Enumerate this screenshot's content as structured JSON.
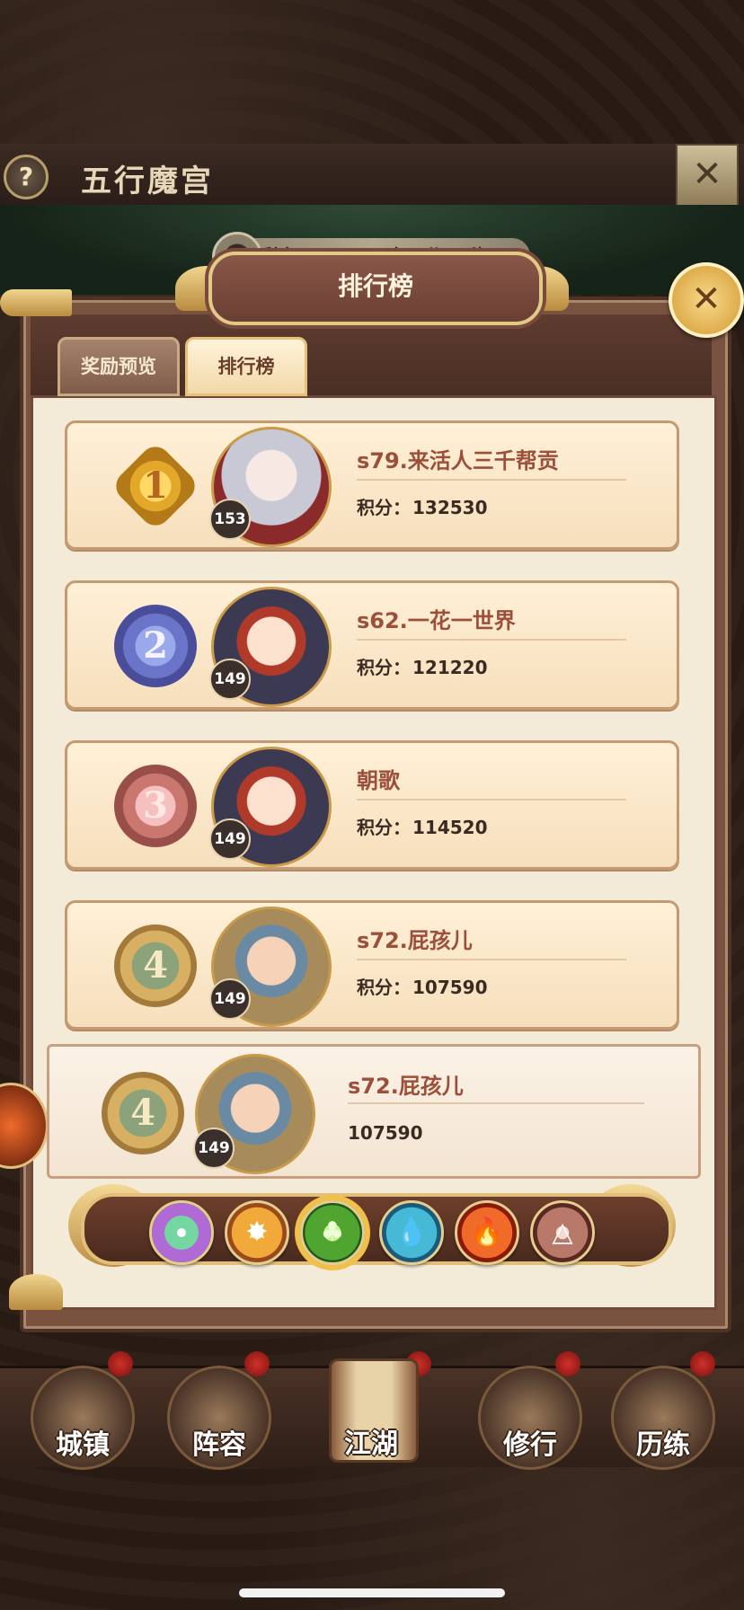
{
  "header": {
    "help_label": "?",
    "mode_title": "五行魔宫",
    "close_icon_glyph": "✕",
    "timer_text": "剩余：11天20时52分34秒"
  },
  "panel": {
    "title": "排行榜",
    "close_glyph": "✕",
    "tabs": [
      {
        "label": "奖励预览",
        "active": false
      },
      {
        "label": "排行榜",
        "active": true
      }
    ]
  },
  "score_prefix": "积分：",
  "rankings": [
    {
      "rank": "1",
      "level": "153",
      "name": "s79.来活人三千帮贡",
      "score": "132530",
      "medal": "gold"
    },
    {
      "rank": "2",
      "level": "149",
      "name": "s62.一花一世界",
      "score": "121220",
      "medal": "silver"
    },
    {
      "rank": "3",
      "level": "149",
      "name": "朝歌",
      "score": "114520",
      "medal": "bronze"
    },
    {
      "rank": "4",
      "level": "149",
      "name": "s72.屁孩儿",
      "score": "107590",
      "medal": "green"
    }
  ],
  "my_rank": {
    "rank": "4",
    "level": "149",
    "name": "s72.屁孩儿",
    "score": "107590"
  },
  "elements": [
    {
      "name": "all-element",
      "glyph": ""
    },
    {
      "name": "metal",
      "glyph": "✸"
    },
    {
      "name": "wood",
      "glyph": "♣"
    },
    {
      "name": "water",
      "glyph": "💧"
    },
    {
      "name": "fire",
      "glyph": "🔥"
    },
    {
      "name": "earth",
      "glyph": "△"
    }
  ],
  "bottom_nav": [
    {
      "label": "城镇"
    },
    {
      "label": "阵容"
    },
    {
      "label": "江湖"
    },
    {
      "label": "修行"
    },
    {
      "label": "历练"
    }
  ],
  "colors": {
    "accent_gold": "#e3c07a",
    "name_red": "#9c4f39",
    "panel_brown": "#7a5240"
  }
}
